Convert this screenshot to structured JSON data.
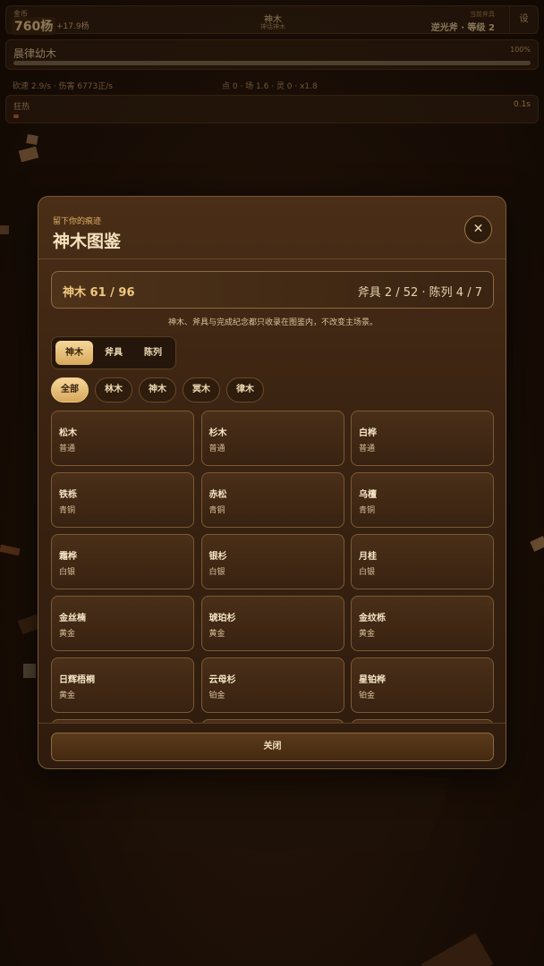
{
  "hud": {
    "coins_label": "金币",
    "coins": "760杨",
    "coins_rate": "+17.9杨",
    "tree_name": "神木",
    "tree_sub": "神话神木",
    "axe_label": "当前斧具",
    "axe_value": "逆光斧 · 等级 2",
    "settings": "设",
    "progress_name": "晨律幼木",
    "progress_pct_text": "100%",
    "progress_value": 1.0,
    "stats_left": "砍速 2.9/s · 伤害 6773正/s",
    "stats_mid": "点 0 · 场 1.6 · 灵 0 · x1.8",
    "rage_label": "狂热",
    "rage_time": "0.1s"
  },
  "modal": {
    "kicker": "留下你的痕迹",
    "title": "神木图鉴",
    "close_icon": "close-icon",
    "summary_left": "神木 61 / 96",
    "summary_right": "斧具 2 / 52 · 陈列 4 / 7",
    "note": "神木、斧具与完成纪念都只收录在图鉴内，不改变主场景。",
    "tabs": [
      "神木",
      "斧具",
      "陈列"
    ],
    "active_tab": "神木",
    "filters": [
      "全部",
      "林木",
      "神木",
      "冥木",
      "律木"
    ],
    "active_filter": "全部",
    "cards": [
      {
        "name": "松木",
        "tier": "普通"
      },
      {
        "name": "杉木",
        "tier": "普通"
      },
      {
        "name": "白桦",
        "tier": "普通"
      },
      {
        "name": "铁栎",
        "tier": "青铜"
      },
      {
        "name": "赤松",
        "tier": "青铜"
      },
      {
        "name": "乌檀",
        "tier": "青铜"
      },
      {
        "name": "霜桦",
        "tier": "白银"
      },
      {
        "name": "银杉",
        "tier": "白银"
      },
      {
        "name": "月桂",
        "tier": "白银"
      },
      {
        "name": "金丝楠",
        "tier": "黄金"
      },
      {
        "name": "琥珀杉",
        "tier": "黄金"
      },
      {
        "name": "金纹栎",
        "tier": "黄金"
      },
      {
        "name": "日辉梧桐",
        "tier": "黄金"
      },
      {
        "name": "云母杉",
        "tier": "铂金"
      },
      {
        "name": "星铂桦",
        "tier": "铂金"
      }
    ],
    "close_label": "关闭"
  }
}
